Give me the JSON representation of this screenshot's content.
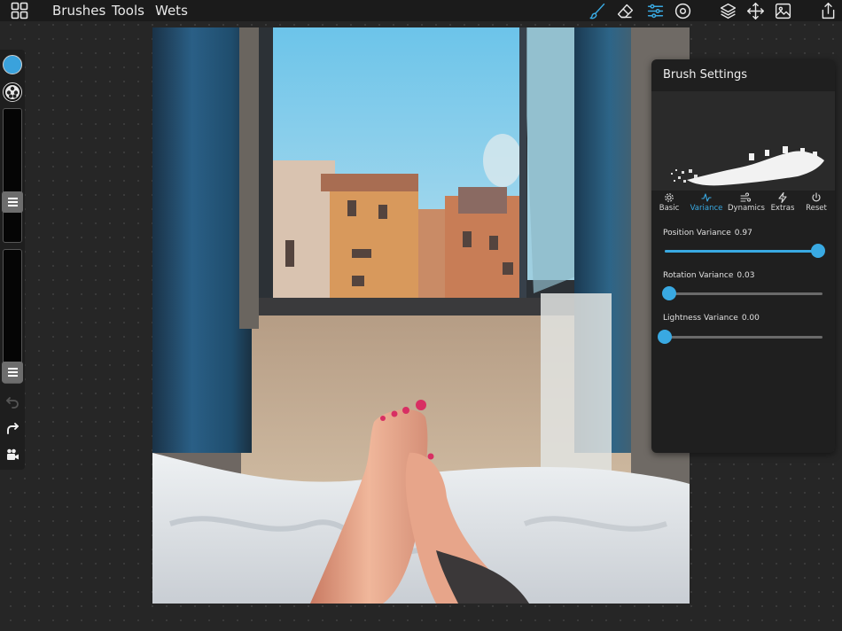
{
  "menu": {
    "brushes": "Brushes",
    "tools": "Tools",
    "wets": "Wets"
  },
  "toolbar_icons": [
    "brush-icon",
    "eraser-icon",
    "sliders-icon",
    "target-icon",
    "layers-icon",
    "move-icon",
    "image-icon",
    "share-icon"
  ],
  "active_tool_color": "#39a9e2",
  "current_color": "#3aa2dc",
  "panel": {
    "title": "Brush Settings",
    "tabs": [
      {
        "label": "Basic",
        "icon": "gear-icon"
      },
      {
        "label": "Variance",
        "icon": "waveform-icon"
      },
      {
        "label": "Dynamics",
        "icon": "wind-icon"
      },
      {
        "label": "Extras",
        "icon": "lightning-icon"
      },
      {
        "label": "Reset",
        "icon": "power-icon"
      }
    ],
    "active_tab": "Variance",
    "settings": [
      {
        "label": "Position Variance",
        "value": "0.97",
        "level": 0.97
      },
      {
        "label": "Rotation Variance",
        "value": "0.03",
        "level": 0.03
      },
      {
        "label": "Lightness Variance",
        "value": "0.00",
        "level": 0.0
      }
    ]
  }
}
